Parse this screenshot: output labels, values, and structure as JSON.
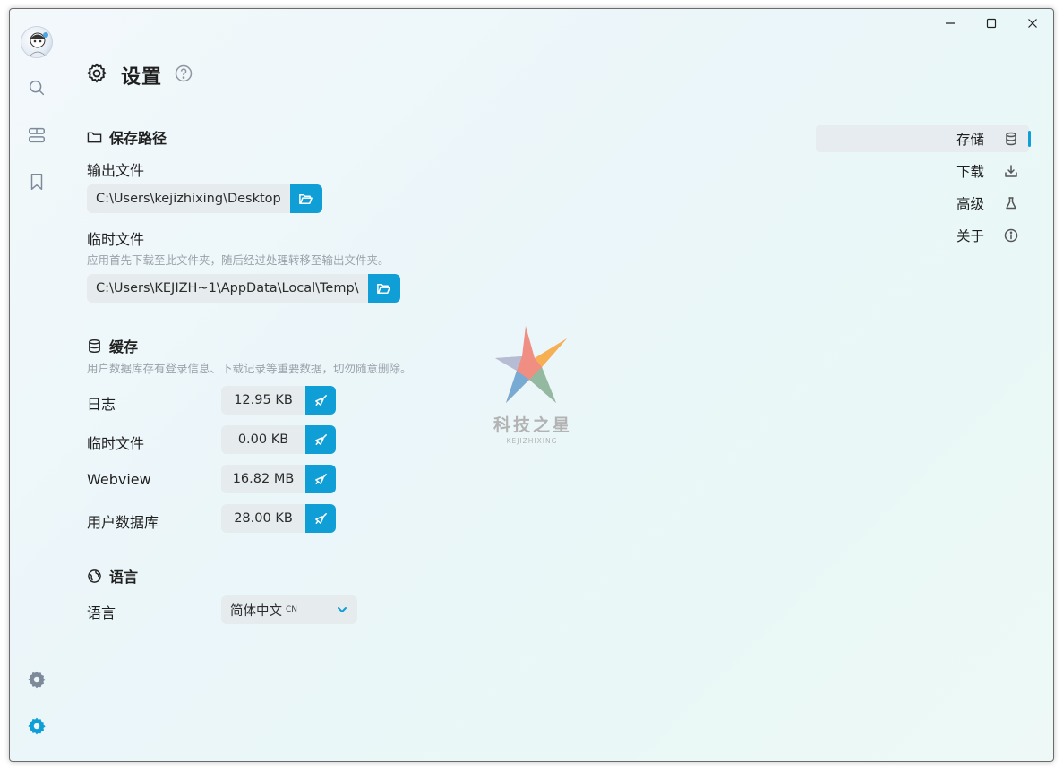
{
  "window": {
    "minimize_label": "",
    "maximize_label": "",
    "close_label": ""
  },
  "sidebar": {
    "icons": [
      "search-icon",
      "layers-icon",
      "bookmark-icon",
      "theme-gear-icon",
      "settings-gear-icon"
    ],
    "active_color": "#0f9fd6"
  },
  "header": {
    "title": "设置"
  },
  "storage_path": {
    "title": "保存路径",
    "output_label": "输出文件",
    "output_value": "C:\\Users\\kejizhixing\\Desktop",
    "temp_label": "临时文件",
    "temp_hint": "应用首先下载至此文件夹，随后经过处理转移至输出文件夹。",
    "temp_value": "C:\\Users\\KEJIZH~1\\AppData\\Local\\Temp\\"
  },
  "cache": {
    "title": "缓存",
    "hint": "用户数据库存有登录信息、下载记录等重要数据，切勿随意删除。",
    "items": [
      {
        "label": "日志",
        "size": "12.95 KB"
      },
      {
        "label": "临时文件",
        "size": "0.00 KB"
      },
      {
        "label": "Webview",
        "size": "16.82 MB"
      },
      {
        "label": "用户数据库",
        "size": "28.00 KB"
      }
    ]
  },
  "language": {
    "title": "语言",
    "label": "语言",
    "selected": "简体中文",
    "selected_code": "CN"
  },
  "right_nav": {
    "items": [
      {
        "label": "存储",
        "icon": "database-icon",
        "active": true
      },
      {
        "label": "下载",
        "icon": "download-icon",
        "active": false
      },
      {
        "label": "高级",
        "icon": "flask-icon",
        "active": false
      },
      {
        "label": "关于",
        "icon": "info-icon",
        "active": false
      }
    ]
  },
  "watermark": {
    "title": "科技之星",
    "subtitle": "KEJIZHIXING"
  },
  "colors": {
    "accent": "#0f9fd6",
    "field_bg": "#e6ebee"
  }
}
